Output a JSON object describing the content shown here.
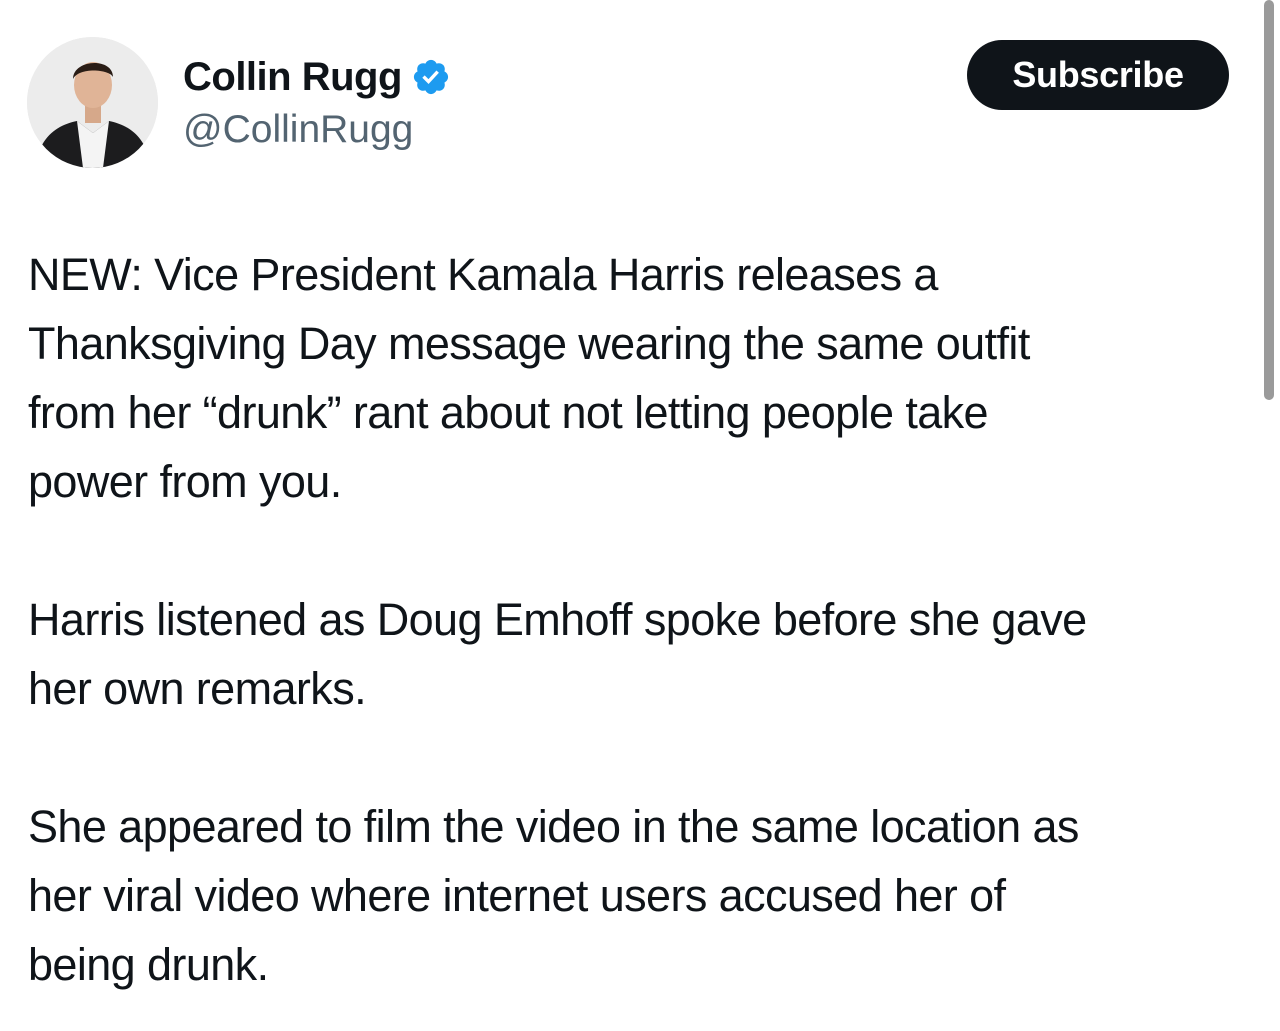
{
  "author": {
    "display_name": "Collin Rugg",
    "handle": "@CollinRugg",
    "verified": true,
    "badge_color": "#1d9bf0"
  },
  "actions": {
    "subscribe_label": "Subscribe"
  },
  "tweet": {
    "paragraphs": [
      {
        "lines": [
          "NEW: Vice President Kamala Harris releases a",
          "Thanksgiving Day message wearing the same outfit",
          "from her “drunk” rant about not letting people take",
          "power from you."
        ]
      },
      {
        "lines": [
          "Harris listened as Doug Emhoff spoke before she gave",
          "her own remarks."
        ]
      },
      {
        "lines": [
          "She appeared to film the video in the same location as",
          "her viral video where internet users accused her of",
          "being drunk."
        ]
      }
    ]
  },
  "colors": {
    "text": "#0f1419",
    "handle": "#536471",
    "button_bg": "#0f1419",
    "button_text": "#ffffff"
  }
}
